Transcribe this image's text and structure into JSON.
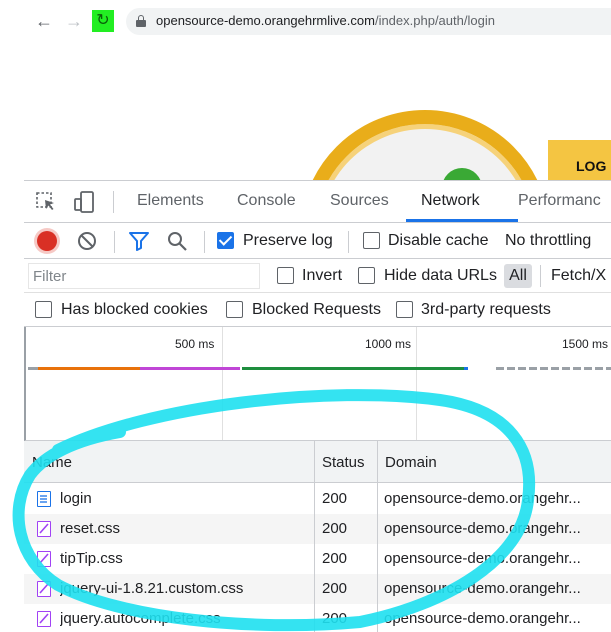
{
  "browser": {
    "url_host": "opensource-demo.orangehrmlive.com",
    "url_path": "/index.php/auth/login"
  },
  "page": {
    "login_label": "LOG"
  },
  "devtools": {
    "tabs": [
      {
        "label": "Elements",
        "active": false
      },
      {
        "label": "Console",
        "active": false
      },
      {
        "label": "Sources",
        "active": false
      },
      {
        "label": "Network",
        "active": true
      },
      {
        "label": "Performanc",
        "active": false
      }
    ],
    "toolbar": {
      "preserve_log_label": "Preserve log",
      "preserve_log_checked": true,
      "disable_cache_label": "Disable cache",
      "disable_cache_checked": false,
      "throttling_label": "No throttling"
    },
    "filter": {
      "placeholder": "Filter",
      "invert_label": "Invert",
      "hide_data_urls_label": "Hide data URLs",
      "all_label": "All",
      "type_label": "Fetch/X"
    },
    "blocked": {
      "has_blocked_cookies_label": "Has blocked cookies",
      "blocked_requests_label": "Blocked Requests",
      "third_party_label": "3rd-party requests"
    },
    "overview": {
      "ticks": [
        "500 ms",
        "1000 ms",
        "1500 ms"
      ],
      "segment_colors": [
        "#e8710a",
        "#c046d6",
        "#1e8e3e",
        "#1a73e8"
      ]
    },
    "table": {
      "headers": {
        "name": "Name",
        "status": "Status",
        "domain": "Domain"
      },
      "rows": [
        {
          "name": "login",
          "status": "200",
          "domain": "opensource-demo.orangehr...",
          "type": "document"
        },
        {
          "name": "reset.css",
          "status": "200",
          "domain": "opensource-demo.orangehr...",
          "type": "stylesheet"
        },
        {
          "name": "tipTip.css",
          "status": "200",
          "domain": "opensource-demo.orangehr...",
          "type": "stylesheet"
        },
        {
          "name": "jquery-ui-1.8.21.custom.css",
          "status": "200",
          "domain": "opensource-demo.orangehr...",
          "type": "stylesheet"
        },
        {
          "name": "jquery.autocomplete.css",
          "status": "200",
          "domain": "opensource-demo.orangehr...",
          "type": "stylesheet"
        }
      ]
    }
  },
  "colors": {
    "accent": "#1a73e8",
    "record": "#d93025",
    "annotation": "#1ee0ef",
    "reload_highlight": "#22ee22",
    "document_icon": "#1a73e8",
    "stylesheet_icon": "#a142f4"
  }
}
